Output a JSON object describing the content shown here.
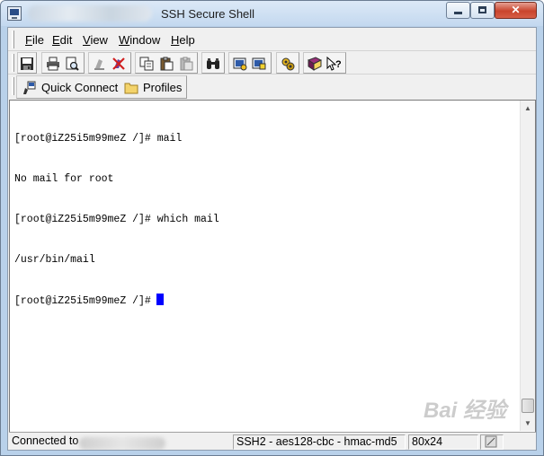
{
  "window": {
    "title": "SSH Secure Shell",
    "min_icon": "minimize-icon",
    "max_icon": "maximize-icon",
    "close_glyph": "✕"
  },
  "menu": {
    "items": [
      {
        "label": "File"
      },
      {
        "label": "Edit"
      },
      {
        "label": "View"
      },
      {
        "label": "Window"
      },
      {
        "label": "Help"
      }
    ]
  },
  "toolbar": {
    "icons": [
      "save-icon",
      "print-icon",
      "print-preview-icon",
      "disconnect-icon",
      "cut-icon",
      "copy-icon",
      "paste-icon",
      "paste-disabled-icon",
      "find-icon",
      "settings-icon",
      "profiles-icon",
      "file-transfer-icon",
      "help-book-icon",
      "context-help-icon"
    ]
  },
  "quick_connect": {
    "label": "Quick Connect",
    "profiles_label": "Profiles"
  },
  "terminal": {
    "lines": [
      "[root@iZ25i5m99meZ /]# mail",
      "No mail for root",
      "[root@iZ25i5m99meZ /]# which mail",
      "/usr/bin/mail",
      "[root@iZ25i5m99meZ /]#"
    ]
  },
  "status": {
    "connected_label": "Connected to",
    "cipher": "SSH2 - aes128-cbc - hmac-md5",
    "size": "80x24"
  },
  "watermark": "Bai 经验",
  "colors": {
    "cursor": "#0000ff",
    "close_button": "#c9442d"
  }
}
